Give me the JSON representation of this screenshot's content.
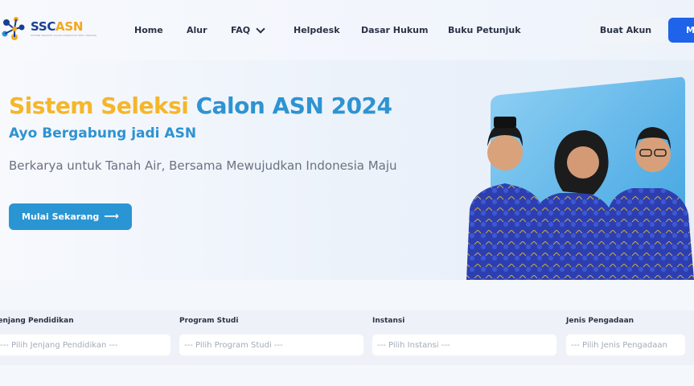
{
  "brand": {
    "name_ssc": "SSC",
    "name_asn": "ASN",
    "tagline": "SISTEM SELEKSI CALON APARATUR SIPIL NEGARA"
  },
  "nav": {
    "items": [
      "Home",
      "Alur",
      "FAQ",
      "Helpdesk",
      "Dasar Hukum",
      "Buku Petunjuk"
    ],
    "register_label": "Buat Akun",
    "login_label": "M"
  },
  "hero": {
    "title_part1": "Sistem Seleksi",
    "title_part2": "Calon ASN 2024",
    "subtitle": "Ayo Bergabung jadi ASN",
    "description": "Berkarya untuk Tanah Air, Bersama Mewujudkan Indonesia Maju",
    "cta_label": "Mulai Sekarang",
    "cta_icon": "arrow-right-icon"
  },
  "filters": [
    {
      "label": "Jenjang Pendidikan",
      "placeholder": "--- Pilih Jenjang Pendidikan ---"
    },
    {
      "label": "Program Studi",
      "placeholder": "--- Pilih Program Studi ---"
    },
    {
      "label": "Instansi",
      "placeholder": "--- Pilih Instansi ---"
    },
    {
      "label": "Jenis Pengadaan",
      "placeholder": "--- Pilih Jenis Pengadaan"
    }
  ],
  "colors": {
    "accent_yellow": "#f5b62a",
    "accent_blue": "#2e93d1",
    "primary_button": "#1e63e9"
  }
}
